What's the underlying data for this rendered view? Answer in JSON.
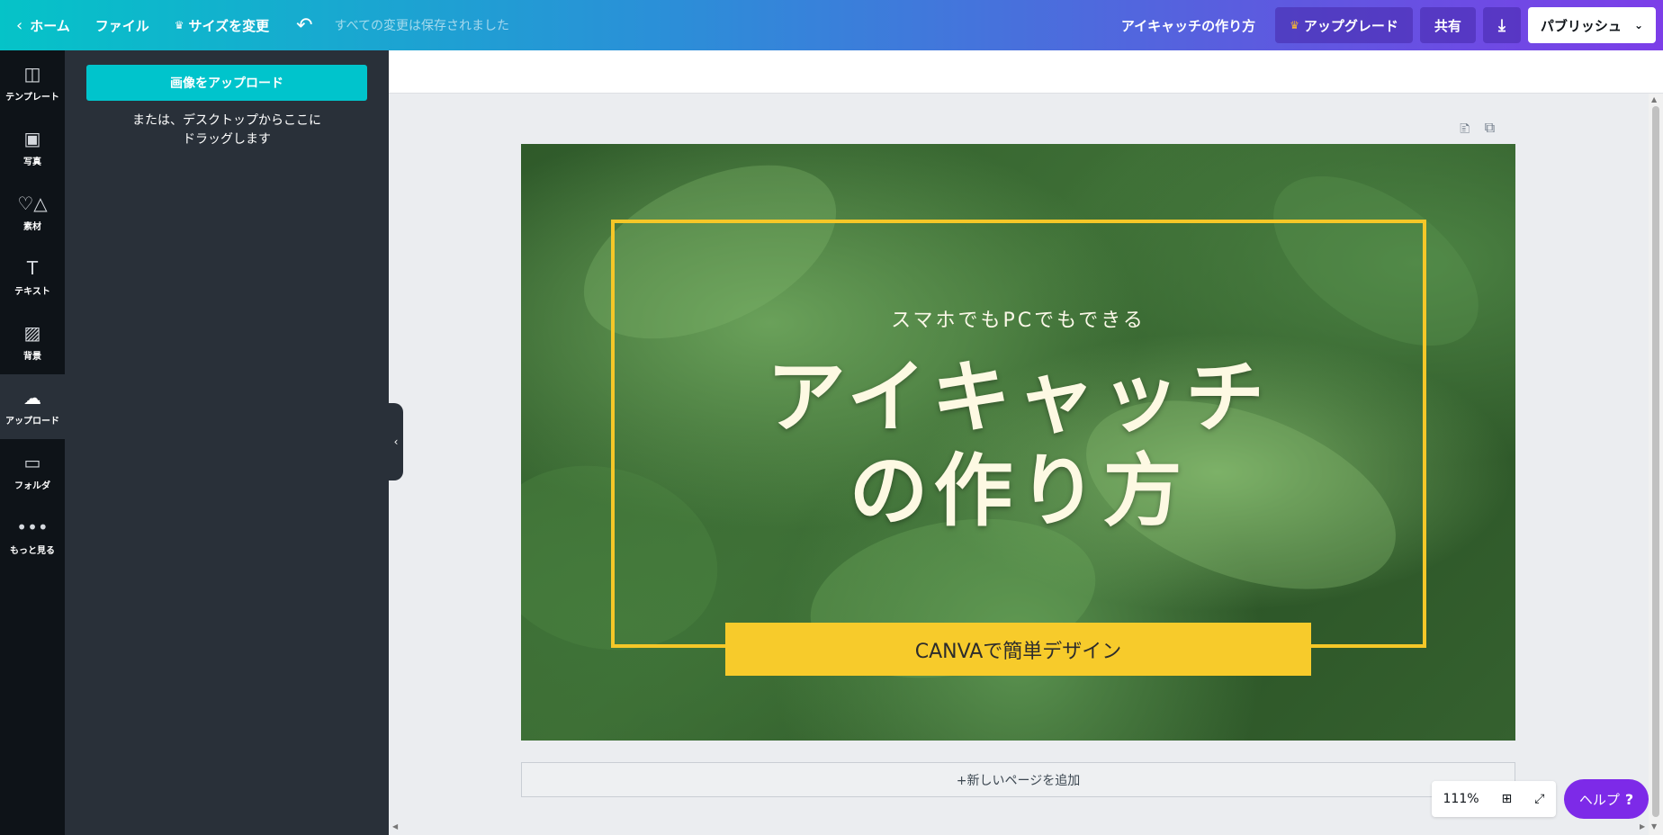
{
  "topbar": {
    "home_label": "ホーム",
    "file_label": "ファイル",
    "resize_label": "サイズを変更",
    "saved_status": "すべての変更は保存されました",
    "doc_title": "アイキャッチの作り方",
    "upgrade_label": "アップグレード",
    "share_label": "共有",
    "publish_label": "パブリッシュ"
  },
  "rail": {
    "items": [
      {
        "label": "テンプレート",
        "icon": "layout-icon"
      },
      {
        "label": "写真",
        "icon": "image-icon"
      },
      {
        "label": "素材",
        "icon": "shapes-icon"
      },
      {
        "label": "テキスト",
        "icon": "text-icon"
      },
      {
        "label": "背景",
        "icon": "pattern-icon"
      },
      {
        "label": "アップロード",
        "icon": "cloud-upload-icon"
      },
      {
        "label": "フォルダ",
        "icon": "folder-icon"
      },
      {
        "label": "もっと見る",
        "icon": "more-icon"
      }
    ]
  },
  "panel": {
    "upload_button": "画像をアップロード",
    "hint_line1": "または、デスクトップからここに",
    "hint_line2": "ドラッグします"
  },
  "design": {
    "subtitle": "スマホでもPCでもできる",
    "headline_line1": "アイキャッチ",
    "headline_line2": "の作り方",
    "banner_text": "CANVAで簡単デザイン"
  },
  "canvas": {
    "add_page_label": "+新しいページを追加",
    "zoom_level": "111%",
    "help_label": "ヘルプ",
    "help_mark": "?"
  },
  "colors": {
    "accent_teal": "#00c4cc",
    "frame_yellow": "#f5c728",
    "help_purple": "#7d2ae8"
  }
}
